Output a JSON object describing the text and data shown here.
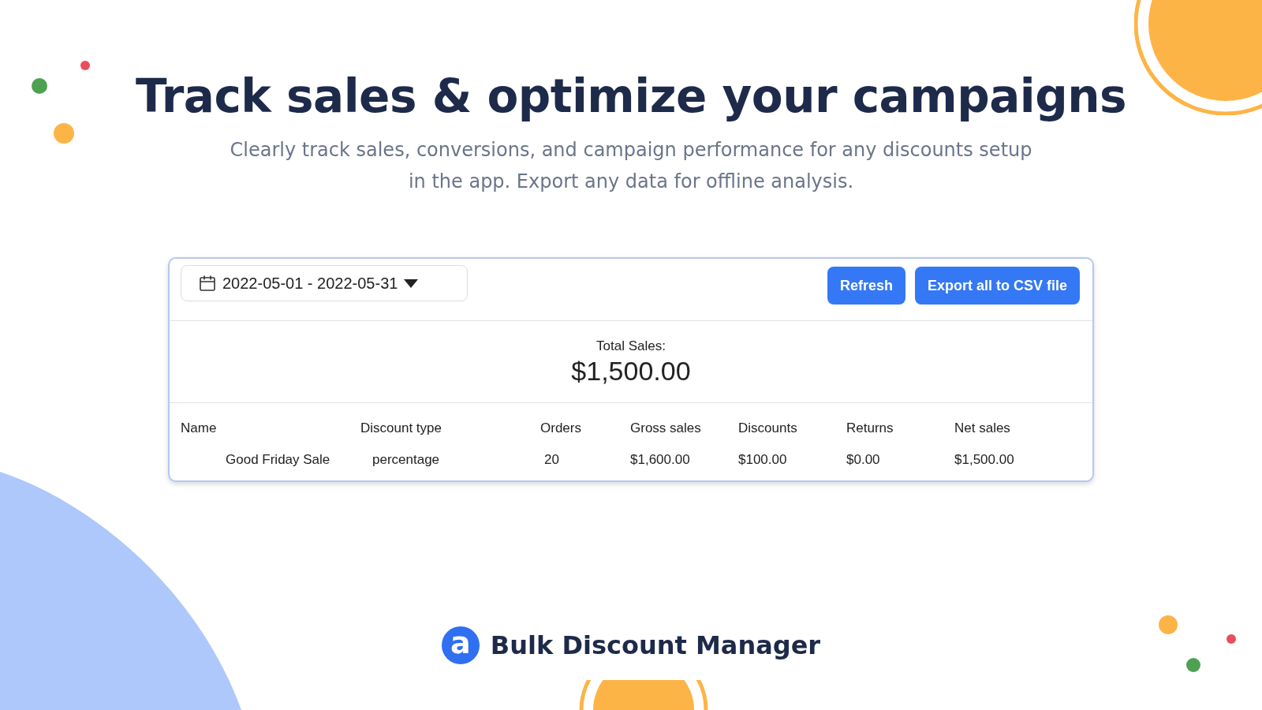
{
  "headline": "Track sales & optimize your campaigns",
  "subtitle_lines": [
    "Clearly track sales, conversions, and campaign performance for any discounts setup",
    "in the app. Export any data for offline analysis."
  ],
  "panel": {
    "date_range": "2022-05-01 - 2022-05-31",
    "buttons": [
      "Refresh",
      "Export all to CSV file"
    ],
    "total_label": "Total Sales:",
    "total_value": "$1,500.00",
    "table": {
      "columns": [
        "Name",
        "Discount type",
        "Orders",
        "Gross sales",
        "Discounts",
        "Returns",
        "Net sales"
      ],
      "rows": [
        [
          "Good Friday Sale",
          "percentage",
          "20",
          "$1,600.00",
          "$100.00",
          "$0.00",
          "$1,500.00"
        ]
      ]
    }
  },
  "brand": {
    "logo_letter": "a",
    "name": "Bulk Discount Manager"
  }
}
